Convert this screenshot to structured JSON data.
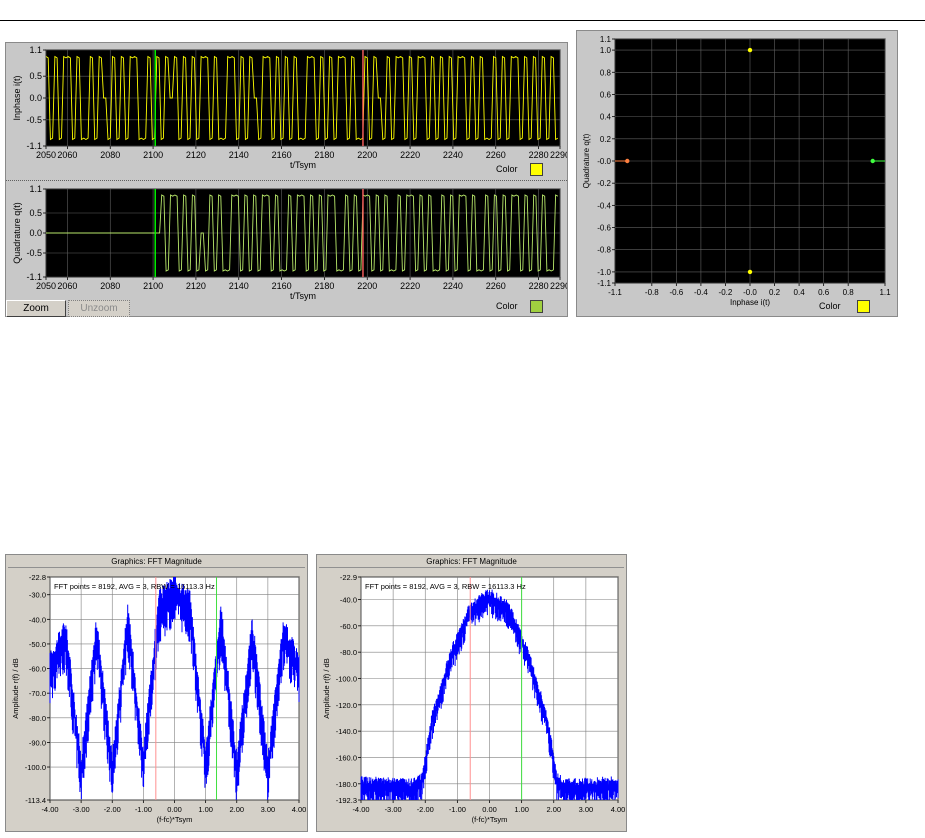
{
  "panels": {
    "iq_time": {
      "zoom_label": "Zoom",
      "unzoom_label": "Unzoom",
      "color_label_top": "Color",
      "color_label_bottom": "Color",
      "top_color": "#ffff00",
      "bottom_color": "#a0d040"
    },
    "constellation": {
      "color_label": "Color",
      "color": "#ffff00"
    },
    "fft_left": {
      "window_title": "Graphics: FFT Magnitude"
    },
    "fft_right": {
      "window_title": "Graphics: FFT Magnitude"
    }
  },
  "chart_data": [
    {
      "type": "line",
      "ylabel": "Inphase i(t)",
      "xlabel": "t/Tsym",
      "xlim": [
        2050,
        2290
      ],
      "ylim": [
        -1.1,
        1.1
      ],
      "xticks": [
        "2050",
        "2060",
        "2080",
        "2100",
        "2120",
        "2140",
        "2160",
        "2180",
        "2200",
        "2220",
        "2240",
        "2260",
        "2280",
        "2290"
      ],
      "yticks": [
        "1.1",
        "0.5",
        "0.0",
        "-0.5",
        "-1.1"
      ],
      "grid": true,
      "series_color": "#ffff00",
      "markers": [
        {
          "x": 2101,
          "color": "#00ff00"
        },
        {
          "x": 2198,
          "color": "#ff6060"
        }
      ],
      "symbols": [
        1,
        -1,
        1,
        -1,
        1,
        1,
        -1,
        1,
        -1,
        -1,
        1,
        -1,
        1,
        0,
        -1,
        1,
        -1,
        1,
        -1,
        1,
        1,
        -1,
        -1,
        1,
        -1,
        1,
        -1,
        1,
        0,
        1,
        -1,
        1,
        -1,
        1,
        -1,
        1,
        1,
        -1,
        1,
        -1,
        -1,
        1,
        1,
        -1,
        1,
        -1,
        1,
        0,
        -1,
        1,
        1,
        -1,
        1,
        -1,
        1,
        -1,
        1,
        -1,
        -1,
        1,
        1,
        -1,
        1,
        -1,
        1,
        -1,
        1,
        1,
        -1,
        1,
        -1,
        -1,
        1,
        -1,
        1,
        0,
        -1,
        1,
        -1,
        1,
        1,
        -1,
        1,
        -1,
        1,
        1,
        -1,
        1,
        -1,
        1,
        -1,
        1,
        -1,
        1,
        1,
        -1,
        1,
        -1,
        1,
        -1,
        -1,
        1,
        -1,
        1,
        -1,
        1,
        1,
        -1,
        1,
        -1,
        1,
        -1,
        1,
        -1,
        1,
        -1
      ]
    },
    {
      "type": "line",
      "ylabel": "Quadrature q(t)",
      "xlabel": "t/Tsym",
      "xlim": [
        2050,
        2290
      ],
      "ylim": [
        -1.1,
        1.1
      ],
      "xticks": [
        "2050",
        "2060",
        "2080",
        "2100",
        "2120",
        "2140",
        "2160",
        "2180",
        "2200",
        "2220",
        "2240",
        "2260",
        "2280",
        "2290"
      ],
      "yticks": [
        "1.1",
        "0.5",
        "0.0",
        "-0.5",
        "-1.1"
      ],
      "grid": true,
      "series_color": "#b8e86a",
      "markers": [
        {
          "x": 2101,
          "color": "#00ff00"
        },
        {
          "x": 2198,
          "color": "#ff6060"
        }
      ],
      "start_x": 2102,
      "symbols": [
        0,
        1,
        -1,
        1,
        1,
        -1,
        1,
        -1,
        1,
        -1,
        0,
        -1,
        1,
        -1,
        1,
        -1,
        -1,
        1,
        1,
        -1,
        1,
        -1,
        1,
        -1,
        1,
        1,
        -1,
        1,
        -1,
        -1,
        1,
        -1,
        1,
        1,
        -1,
        1,
        -1,
        1,
        -1,
        1,
        1,
        -1,
        -1,
        1,
        -1,
        1,
        -1,
        1,
        1,
        -1,
        1,
        -1,
        1,
        -1,
        -1,
        1,
        -1,
        1,
        1,
        -1,
        1,
        -1,
        1,
        -1,
        -1,
        1,
        -1,
        1,
        -1,
        1,
        1,
        -1,
        1,
        -1,
        -1,
        1,
        -1,
        1,
        -1,
        1,
        -1,
        1,
        1,
        -1,
        1,
        -1,
        1,
        -1,
        1,
        -1,
        -1,
        1
      ]
    },
    {
      "type": "scatter",
      "ylabel": "Quadrature q(t)",
      "xlabel": "Inphase i(t)",
      "xlim": [
        -1.1,
        1.1
      ],
      "ylim": [
        -1.1,
        1.1
      ],
      "xticks": [
        "-1.1",
        "-0.8",
        "-0.6",
        "-0.4",
        "-0.2",
        "-0.0",
        "0.2",
        "0.4",
        "0.6",
        "0.8",
        "1.1"
      ],
      "yticks": [
        "1.1",
        "1.0",
        "0.8",
        "0.6",
        "0.4",
        "0.2",
        "-0.0",
        "-0.2",
        "-0.4",
        "-0.6",
        "-0.8",
        "-1.0",
        "-1.1"
      ],
      "grid": true,
      "points": [
        {
          "x": 0.0,
          "y": 1.0,
          "color": "#ffff00"
        },
        {
          "x": 0.0,
          "y": -1.0,
          "color": "#ffff00"
        },
        {
          "x": -1.0,
          "y": 0.0,
          "color": "#ff8040"
        },
        {
          "x": 1.0,
          "y": 0.0,
          "color": "#40ff40"
        }
      ]
    },
    {
      "type": "area",
      "annotation": "FFT points = 8192, AVG = 3, RBW = 16113.3 Hz",
      "ylabel": "Amplitude r(f) / dB",
      "xlabel": "(f-fc)*Tsym",
      "xlim": [
        -4.0,
        4.0
      ],
      "ylim": [
        -113.4,
        -22.8
      ],
      "xticks": [
        "-4.00",
        "-3.00",
        "-2.00",
        "-1.00",
        "0.00",
        "1.00",
        "2.00",
        "3.00",
        "4.00"
      ],
      "yticks": [
        "-22.8",
        "-30.0",
        "-40.0",
        "-50.0",
        "-60.0",
        "-70.0",
        "-80.0",
        "-90.0",
        "-100.0",
        "-113.4"
      ],
      "grid": true,
      "series_color": "#0000ff",
      "markers": [
        {
          "x": -0.6,
          "color": "#ff9090"
        },
        {
          "x": 1.35,
          "color": "#40e040"
        }
      ],
      "envelope": [
        [
          -4.0,
          -57
        ],
        [
          -3.5,
          -43
        ],
        [
          -3.0,
          -98
        ],
        [
          -2.5,
          -42
        ],
        [
          -2.0,
          -98
        ],
        [
          -1.5,
          -37
        ],
        [
          -1.0,
          -95
        ],
        [
          -0.5,
          -32
        ],
        [
          0.0,
          -25
        ],
        [
          0.5,
          -32
        ],
        [
          1.0,
          -95
        ],
        [
          1.5,
          -37
        ],
        [
          2.0,
          -98
        ],
        [
          2.5,
          -42
        ],
        [
          3.0,
          -98
        ],
        [
          3.5,
          -43
        ],
        [
          4.0,
          -57
        ]
      ]
    },
    {
      "type": "area",
      "annotation": "FFT points = 8192, AVG = 3, RBW = 16113.3 Hz",
      "ylabel": "Amplitude r(f) / dB",
      "xlabel": "(f-fc)*Tsym",
      "xlim": [
        -4.0,
        4.0
      ],
      "ylim": [
        -192.3,
        -22.9
      ],
      "xticks": [
        "-4.00",
        "-3.00",
        "-2.00",
        "-1.00",
        "0.00",
        "1.00",
        "2.00",
        "3.00",
        "4.00"
      ],
      "yticks": [
        "-22.9",
        "-40.0",
        "-60.0",
        "-80.0",
        "-100.0",
        "-120.0",
        "-140.0",
        "-160.0",
        "-180.0",
        "-192.3"
      ],
      "grid": true,
      "series_color": "#0000ff",
      "markers": [
        {
          "x": -0.6,
          "color": "#ff9090"
        },
        {
          "x": 1.0,
          "color": "#40e040"
        }
      ],
      "envelope": [
        [
          -4.0,
          -178
        ],
        [
          -2.4,
          -180
        ],
        [
          -2.1,
          -175
        ],
        [
          -1.8,
          -130
        ],
        [
          -1.2,
          -80
        ],
        [
          -0.6,
          -45
        ],
        [
          0.0,
          -35
        ],
        [
          0.6,
          -45
        ],
        [
          1.2,
          -80
        ],
        [
          1.8,
          -130
        ],
        [
          2.1,
          -175
        ],
        [
          2.4,
          -180
        ],
        [
          4.0,
          -178
        ]
      ]
    }
  ]
}
